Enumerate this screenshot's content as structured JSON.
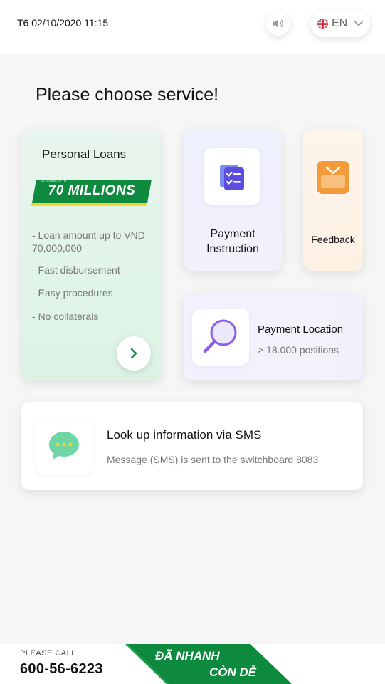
{
  "header": {
    "datetime": "T6 02/10/2020 11:15",
    "language": "EN",
    "language_flag_icon": "uk-flag-icon",
    "sound_icon": "speaker-icon"
  },
  "page_title": "Please choose service!",
  "services": {
    "loans": {
      "title": "Personal Loans",
      "banner_small": "GET LOANS UP TO",
      "banner": "70 MILLIONS",
      "features": [
        "- Loan amount up to VND 70,000,000",
        "- Fast disbursement",
        "- Easy procedures",
        "- No collaterals"
      ],
      "next_icon": "chevron-right-icon"
    },
    "payment_instruction": {
      "label_1": "Payment",
      "label_2": "Instruction",
      "icon": "clipboard-checklist-icon"
    },
    "feedback": {
      "label": "Feedback",
      "icon": "mailbox-icon"
    },
    "payment_location": {
      "title": "Payment Location",
      "subtitle": "> 18.000 positions",
      "icon": "magnifier-icon"
    },
    "sms": {
      "title": "Look up information via SMS",
      "subtitle": "Message (SMS) is sent to the switchboard 8083",
      "icon": "chat-bubble-icon"
    }
  },
  "footer": {
    "call_label": "PLEASE CALL",
    "phone": "600-56-6223",
    "slogan_1": "ĐÃ NHANH",
    "slogan_2": "CÒN DỄ"
  },
  "colors": {
    "brand_green": "#0e8a3e",
    "accent_purple": "#6a5ce8",
    "accent_orange": "#f39a3a"
  }
}
